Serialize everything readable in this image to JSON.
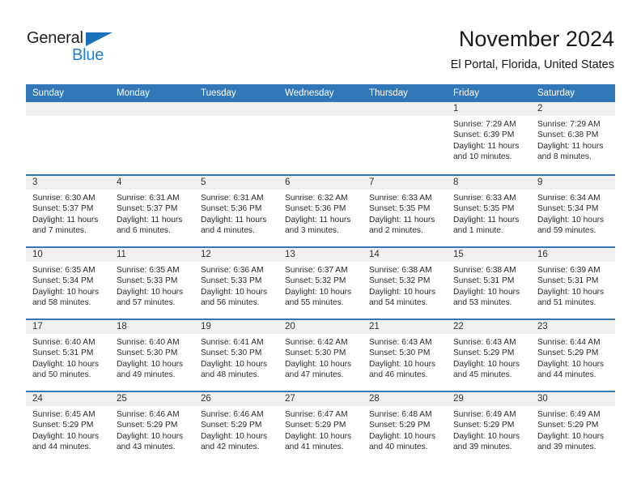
{
  "brand": {
    "name_part1": "General",
    "name_part2": "Blue",
    "accent_color": "#1c7fd4",
    "triangle_color": "#1c6fba"
  },
  "header": {
    "title": "November 2024",
    "location": "El Portal, Florida, United States"
  },
  "calendar": {
    "header_bg": "#3277b8",
    "daynumber_bg": "#f0f0f0",
    "weekdays": [
      "Sunday",
      "Monday",
      "Tuesday",
      "Wednesday",
      "Thursday",
      "Friday",
      "Saturday"
    ],
    "weeks": [
      [
        {
          "day": "",
          "empty": true
        },
        {
          "day": "",
          "empty": true
        },
        {
          "day": "",
          "empty": true
        },
        {
          "day": "",
          "empty": true
        },
        {
          "day": "",
          "empty": true
        },
        {
          "day": "1",
          "sunrise": "Sunrise: 7:29 AM",
          "sunset": "Sunset: 6:39 PM",
          "daylight": "Daylight: 11 hours and 10 minutes."
        },
        {
          "day": "2",
          "sunrise": "Sunrise: 7:29 AM",
          "sunset": "Sunset: 6:38 PM",
          "daylight": "Daylight: 11 hours and 8 minutes."
        }
      ],
      [
        {
          "day": "3",
          "sunrise": "Sunrise: 6:30 AM",
          "sunset": "Sunset: 5:37 PM",
          "daylight": "Daylight: 11 hours and 7 minutes."
        },
        {
          "day": "4",
          "sunrise": "Sunrise: 6:31 AM",
          "sunset": "Sunset: 5:37 PM",
          "daylight": "Daylight: 11 hours and 6 minutes."
        },
        {
          "day": "5",
          "sunrise": "Sunrise: 6:31 AM",
          "sunset": "Sunset: 5:36 PM",
          "daylight": "Daylight: 11 hours and 4 minutes."
        },
        {
          "day": "6",
          "sunrise": "Sunrise: 6:32 AM",
          "sunset": "Sunset: 5:36 PM",
          "daylight": "Daylight: 11 hours and 3 minutes."
        },
        {
          "day": "7",
          "sunrise": "Sunrise: 6:33 AM",
          "sunset": "Sunset: 5:35 PM",
          "daylight": "Daylight: 11 hours and 2 minutes."
        },
        {
          "day": "8",
          "sunrise": "Sunrise: 6:33 AM",
          "sunset": "Sunset: 5:35 PM",
          "daylight": "Daylight: 11 hours and 1 minute."
        },
        {
          "day": "9",
          "sunrise": "Sunrise: 6:34 AM",
          "sunset": "Sunset: 5:34 PM",
          "daylight": "Daylight: 10 hours and 59 minutes."
        }
      ],
      [
        {
          "day": "10",
          "sunrise": "Sunrise: 6:35 AM",
          "sunset": "Sunset: 5:34 PM",
          "daylight": "Daylight: 10 hours and 58 minutes."
        },
        {
          "day": "11",
          "sunrise": "Sunrise: 6:35 AM",
          "sunset": "Sunset: 5:33 PM",
          "daylight": "Daylight: 10 hours and 57 minutes."
        },
        {
          "day": "12",
          "sunrise": "Sunrise: 6:36 AM",
          "sunset": "Sunset: 5:33 PM",
          "daylight": "Daylight: 10 hours and 56 minutes."
        },
        {
          "day": "13",
          "sunrise": "Sunrise: 6:37 AM",
          "sunset": "Sunset: 5:32 PM",
          "daylight": "Daylight: 10 hours and 55 minutes."
        },
        {
          "day": "14",
          "sunrise": "Sunrise: 6:38 AM",
          "sunset": "Sunset: 5:32 PM",
          "daylight": "Daylight: 10 hours and 54 minutes."
        },
        {
          "day": "15",
          "sunrise": "Sunrise: 6:38 AM",
          "sunset": "Sunset: 5:31 PM",
          "daylight": "Daylight: 10 hours and 53 minutes."
        },
        {
          "day": "16",
          "sunrise": "Sunrise: 6:39 AM",
          "sunset": "Sunset: 5:31 PM",
          "daylight": "Daylight: 10 hours and 51 minutes."
        }
      ],
      [
        {
          "day": "17",
          "sunrise": "Sunrise: 6:40 AM",
          "sunset": "Sunset: 5:31 PM",
          "daylight": "Daylight: 10 hours and 50 minutes."
        },
        {
          "day": "18",
          "sunrise": "Sunrise: 6:40 AM",
          "sunset": "Sunset: 5:30 PM",
          "daylight": "Daylight: 10 hours and 49 minutes."
        },
        {
          "day": "19",
          "sunrise": "Sunrise: 6:41 AM",
          "sunset": "Sunset: 5:30 PM",
          "daylight": "Daylight: 10 hours and 48 minutes."
        },
        {
          "day": "20",
          "sunrise": "Sunrise: 6:42 AM",
          "sunset": "Sunset: 5:30 PM",
          "daylight": "Daylight: 10 hours and 47 minutes."
        },
        {
          "day": "21",
          "sunrise": "Sunrise: 6:43 AM",
          "sunset": "Sunset: 5:30 PM",
          "daylight": "Daylight: 10 hours and 46 minutes."
        },
        {
          "day": "22",
          "sunrise": "Sunrise: 6:43 AM",
          "sunset": "Sunset: 5:29 PM",
          "daylight": "Daylight: 10 hours and 45 minutes."
        },
        {
          "day": "23",
          "sunrise": "Sunrise: 6:44 AM",
          "sunset": "Sunset: 5:29 PM",
          "daylight": "Daylight: 10 hours and 44 minutes."
        }
      ],
      [
        {
          "day": "24",
          "sunrise": "Sunrise: 6:45 AM",
          "sunset": "Sunset: 5:29 PM",
          "daylight": "Daylight: 10 hours and 44 minutes."
        },
        {
          "day": "25",
          "sunrise": "Sunrise: 6:46 AM",
          "sunset": "Sunset: 5:29 PM",
          "daylight": "Daylight: 10 hours and 43 minutes."
        },
        {
          "day": "26",
          "sunrise": "Sunrise: 6:46 AM",
          "sunset": "Sunset: 5:29 PM",
          "daylight": "Daylight: 10 hours and 42 minutes."
        },
        {
          "day": "27",
          "sunrise": "Sunrise: 6:47 AM",
          "sunset": "Sunset: 5:29 PM",
          "daylight": "Daylight: 10 hours and 41 minutes."
        },
        {
          "day": "28",
          "sunrise": "Sunrise: 6:48 AM",
          "sunset": "Sunset: 5:29 PM",
          "daylight": "Daylight: 10 hours and 40 minutes."
        },
        {
          "day": "29",
          "sunrise": "Sunrise: 6:49 AM",
          "sunset": "Sunset: 5:29 PM",
          "daylight": "Daylight: 10 hours and 39 minutes."
        },
        {
          "day": "30",
          "sunrise": "Sunrise: 6:49 AM",
          "sunset": "Sunset: 5:29 PM",
          "daylight": "Daylight: 10 hours and 39 minutes."
        }
      ]
    ]
  }
}
